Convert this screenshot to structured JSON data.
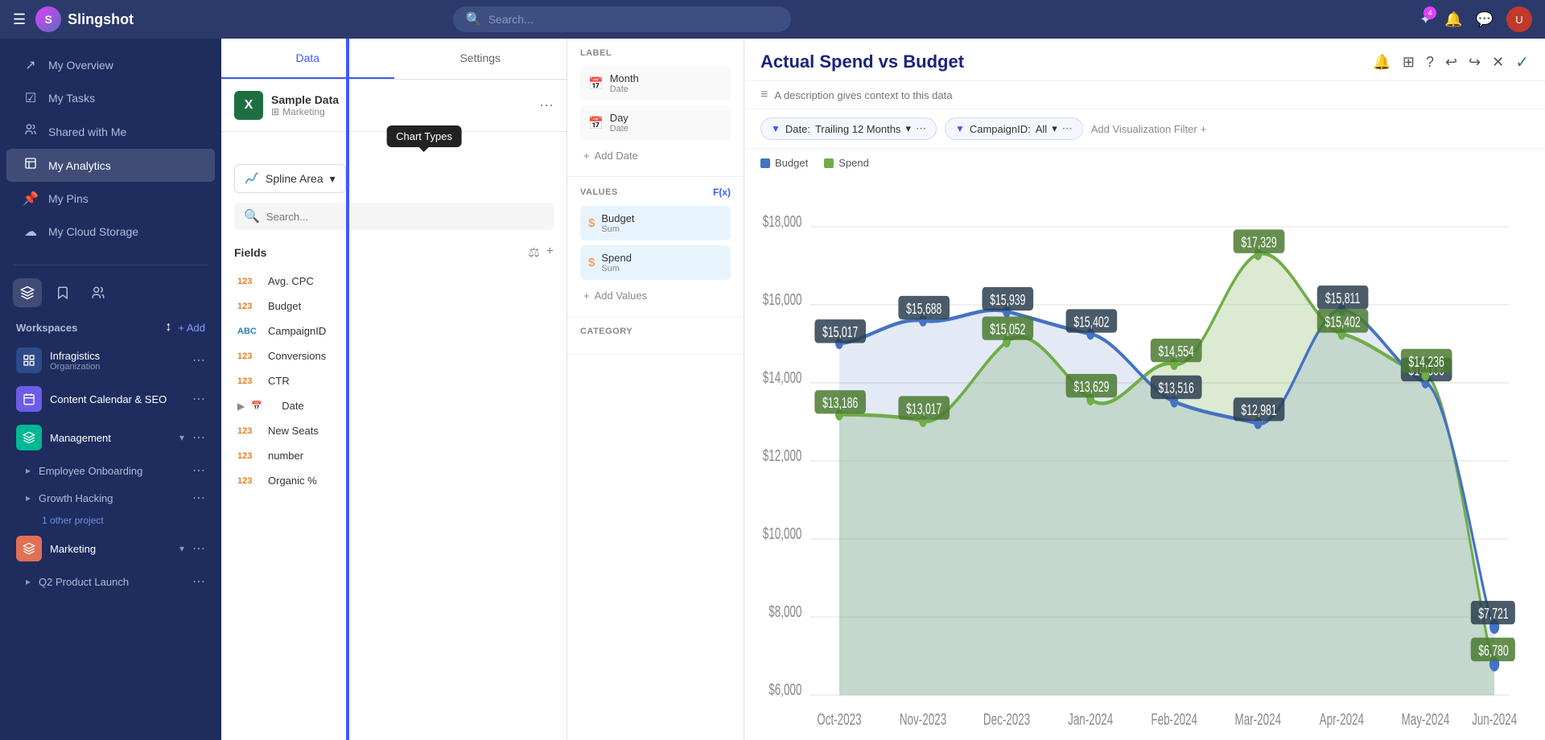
{
  "app": {
    "name": "Slingshot",
    "search_placeholder": "Search..."
  },
  "topnav": {
    "badge_count": "4",
    "avatar_initials": "U"
  },
  "sidebar": {
    "nav_items": [
      {
        "id": "overview",
        "label": "My Overview",
        "icon": "↗"
      },
      {
        "id": "tasks",
        "label": "My Tasks",
        "icon": "☑"
      },
      {
        "id": "shared",
        "label": "Shared with Me",
        "icon": "👥"
      },
      {
        "id": "analytics",
        "label": "My Analytics",
        "icon": "📊"
      },
      {
        "id": "pins",
        "label": "My Pins",
        "icon": "📌"
      },
      {
        "id": "cloud",
        "label": "My Cloud Storage",
        "icon": "☁"
      }
    ],
    "workspaces_title": "Workspaces",
    "add_label": "+ Add",
    "workspaces": [
      {
        "id": "infragistics",
        "name": "Infragistics",
        "sub": "Organization",
        "projects": []
      },
      {
        "id": "content-calendar",
        "name": "Content Calendar & SEO",
        "sub": "",
        "projects": []
      },
      {
        "id": "management",
        "name": "Management",
        "expanded": true,
        "projects": [
          {
            "name": "Employee Onboarding"
          },
          {
            "name": "Growth Hacking"
          }
        ],
        "more": "1 other project"
      },
      {
        "id": "marketing",
        "name": "Marketing",
        "expanded": true,
        "projects": [
          {
            "name": "Q2 Product Launch"
          }
        ]
      }
    ]
  },
  "data_panel": {
    "tabs": [
      "Data",
      "Settings"
    ],
    "active_tab": "Data",
    "data_source": {
      "name": "Sample Data",
      "sub": "Marketing",
      "icon": "X"
    },
    "chart_types_tooltip": "Chart Types",
    "chart_type_selected": "Spline Area",
    "search_placeholder": "Search...",
    "fields_title": "Fields",
    "fields": [
      {
        "type": "123",
        "name": "Avg. CPC"
      },
      {
        "type": "123",
        "name": "Budget"
      },
      {
        "type": "ABC",
        "name": "CampaignID"
      },
      {
        "type": "123",
        "name": "Conversions"
      },
      {
        "type": "123",
        "name": "CTR"
      },
      {
        "type": "DATE",
        "name": "Date",
        "expandable": true
      },
      {
        "type": "123",
        "name": "New Seats"
      },
      {
        "type": "123",
        "name": "number"
      },
      {
        "type": "123",
        "name": "Organic %"
      }
    ]
  },
  "config_panel": {
    "label_title": "LABEL",
    "label_items": [
      {
        "name": "Month",
        "sub": "Date",
        "icon": "📅"
      },
      {
        "name": "Day",
        "sub": "Date",
        "icon": "📅"
      }
    ],
    "add_date_label": "Add Date",
    "values_title": "VALUES",
    "fx_label": "F(x)",
    "value_items": [
      {
        "name": "Budget",
        "sub": "Sum",
        "icon": "$"
      },
      {
        "name": "Spend",
        "sub": "Sum",
        "icon": "$"
      }
    ],
    "add_values_label": "Add Values",
    "category_title": "CATEGORY"
  },
  "chart": {
    "title": "Actual Spend vs Budget",
    "description_placeholder": "A description gives context to this data",
    "filters": [
      {
        "label": "Date:",
        "value": "Trailing 12 Months"
      },
      {
        "label": "CampaignID:",
        "value": "All"
      }
    ],
    "add_filter_label": "Add Visualization Filter",
    "legend": [
      {
        "label": "Budget",
        "color": "#4472c4"
      },
      {
        "label": "Spend",
        "color": "#70ad47"
      }
    ],
    "x_labels": [
      "Oct-2023",
      "Nov-2023",
      "Dec-2023",
      "Jan-2024",
      "Feb-2024",
      "Mar-2024",
      "Apr-2024",
      "May-2024",
      "Jun-2024"
    ],
    "y_labels": [
      "$6,000",
      "$8,000",
      "$10,000",
      "$12,000",
      "$14,000",
      "$16,000",
      "$18,000"
    ],
    "budget_points": [
      15017,
      15688,
      15939,
      15402,
      13516,
      12981,
      15811,
      14006,
      7721
    ],
    "spend_points": [
      13186,
      13017,
      15052,
      13629,
      14554,
      17329,
      15402,
      14236,
      6780
    ],
    "data_labels_budget": [
      "$15,017",
      "$15,688",
      "$15,939",
      "$15,402",
      "$13,516",
      "$12,981",
      "$15,811",
      "$14,006",
      "$7,721"
    ],
    "data_labels_spend": [
      "$13,186",
      "$13,017",
      "$15,052",
      "$13,629",
      "$14,554",
      "$17,329",
      "$15,402",
      "$14,236",
      "$6,780"
    ]
  }
}
